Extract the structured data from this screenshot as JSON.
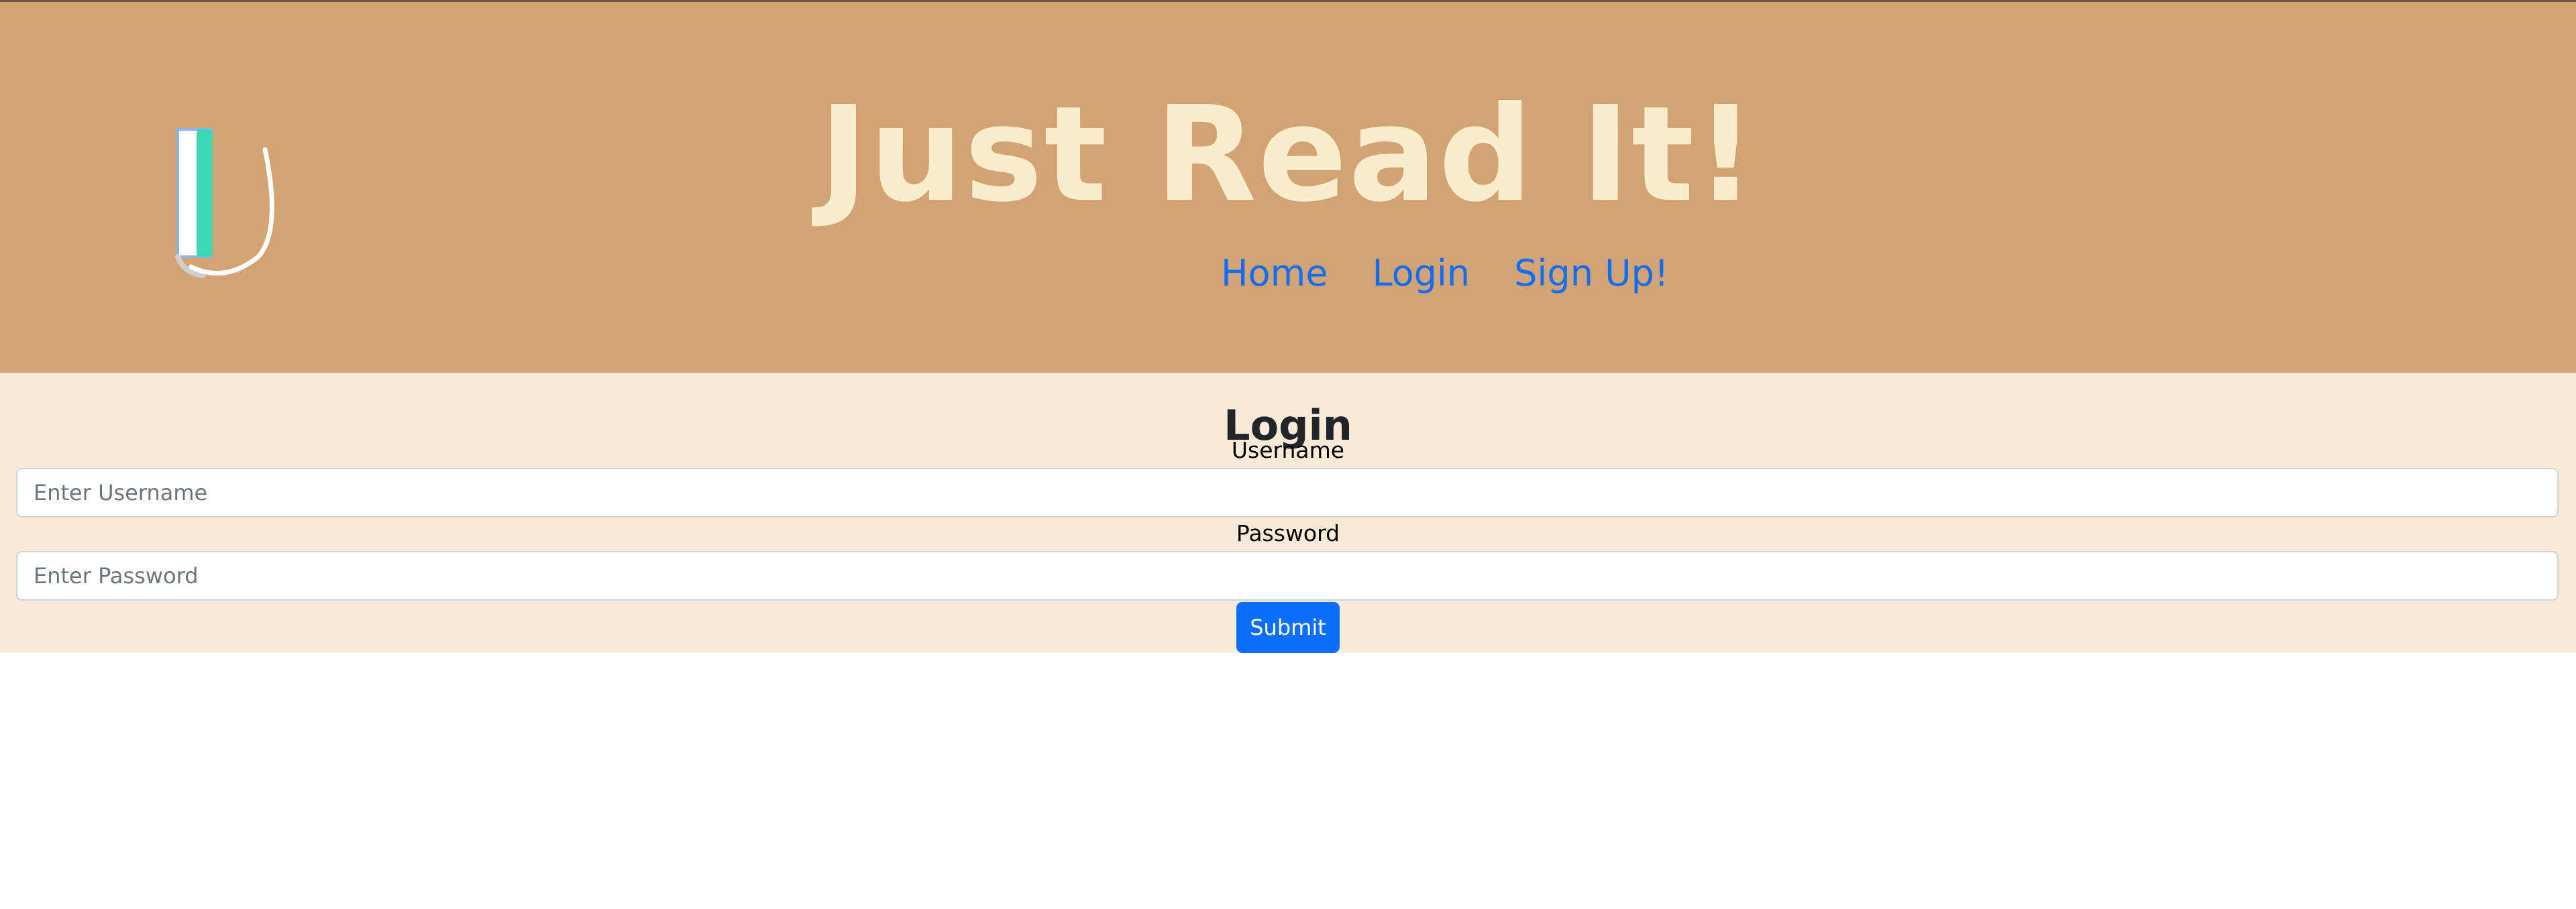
{
  "header": {
    "title": "Just Read It!",
    "logo_icon": "book-logo-icon",
    "nav": [
      {
        "label": "Home"
      },
      {
        "label": "Login"
      },
      {
        "label": "Sign Up!"
      }
    ]
  },
  "login": {
    "heading": "Login",
    "username_label": "Username",
    "username_placeholder": "Enter Username",
    "username_value": "",
    "password_label": "Password",
    "password_placeholder": "Enter Password",
    "password_value": "",
    "submit_label": "Submit"
  },
  "colors": {
    "header_bg": "#d4a373",
    "title_color": "#faedcd",
    "section_bg": "#faebd7",
    "link_color": "#0d6efd",
    "button_bg": "#0d6efd"
  }
}
